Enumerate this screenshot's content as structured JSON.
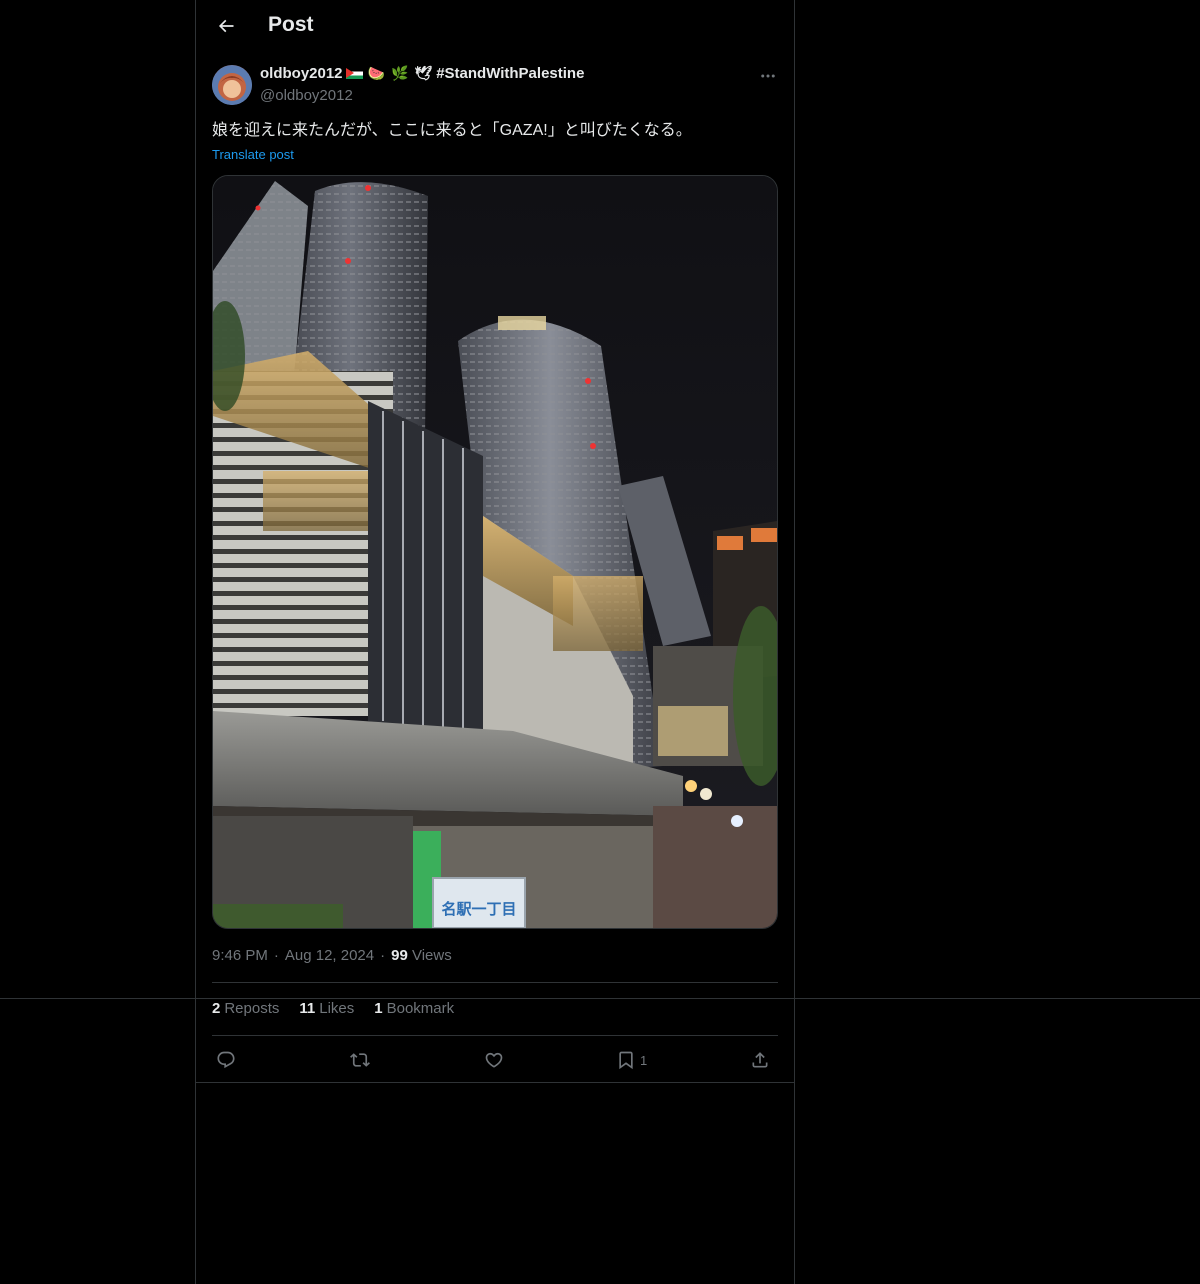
{
  "header": {
    "title": "Post"
  },
  "author": {
    "display_name": "oldboy2012",
    "hashtag": "#StandWithPalestine",
    "handle": "@oldboy2012",
    "emoji_watermelon": "🍉",
    "emoji_olive": "🌿",
    "emoji_dove": "🕊"
  },
  "post": {
    "text": "娘を迎えに来たんだが、ここに来ると「GAZA!」と叫びたくなる。",
    "translate_label": "Translate post",
    "image_sign_text": "名駅一丁目"
  },
  "meta": {
    "time": "9:46 PM",
    "date": "Aug 12, 2024",
    "views_count": "99",
    "views_label": "Views",
    "dot": "·"
  },
  "stats": {
    "reposts_count": "2",
    "reposts_label": "Reposts",
    "likes_count": "11",
    "likes_label": "Likes",
    "bookmarks_count": "1",
    "bookmarks_label": "Bookmark"
  },
  "actions": {
    "bookmark_count": "1"
  },
  "colors": {
    "background": "#000000",
    "border": "#2f3336",
    "text_primary": "#e7e9ea",
    "text_secondary": "#71767b",
    "link": "#1d9bf0"
  },
  "icons": [
    "back-arrow-icon",
    "more-icon",
    "reply-icon",
    "repost-icon",
    "like-icon",
    "bookmark-icon",
    "share-icon"
  ]
}
